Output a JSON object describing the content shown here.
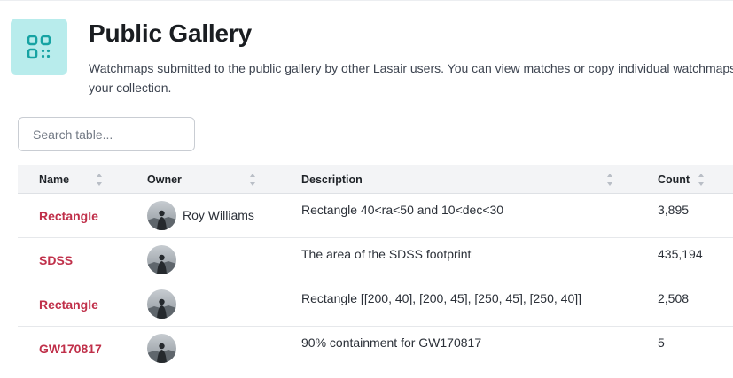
{
  "header": {
    "title": "Public Gallery",
    "description": "Watchmaps submitted to the public gallery by other Lasair users. You can view matches or copy individual watchmaps to your collection.",
    "icon": "qr-code-icon",
    "icon_bg": "#b8ecec",
    "icon_color": "#16a3a3"
  },
  "search": {
    "placeholder": "Search table..."
  },
  "table": {
    "columns": [
      "Name",
      "Owner",
      "Description",
      "Count"
    ],
    "rows": [
      {
        "name": "Rectangle",
        "owner": "Roy Williams",
        "description": "Rectangle 40<ra<50 and 10<dec<30",
        "count": "3,895"
      },
      {
        "name": "SDSS",
        "owner": "",
        "description": "The area of the SDSS footprint",
        "count": "435,194"
      },
      {
        "name": "Rectangle",
        "owner": "",
        "description": "Rectangle [[200, 40], [200, 45], [250, 45], [250, 40]]",
        "count": "2,508"
      },
      {
        "name": "GW170817",
        "owner": "",
        "description": "90% containment for GW170817",
        "count": "5"
      }
    ]
  },
  "colors": {
    "link": "#c0304a",
    "header_bg": "#f3f4f6"
  }
}
